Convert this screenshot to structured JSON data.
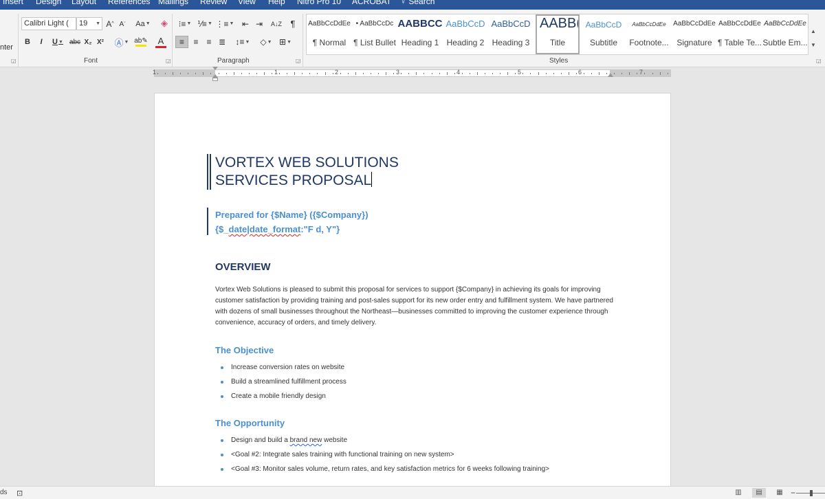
{
  "menu": {
    "tabs": [
      "Insert",
      "Design",
      "Layout",
      "References",
      "Mailings",
      "Review",
      "View",
      "Help",
      "Nitro Pro 10",
      "ACROBAT"
    ],
    "search_label": "Search"
  },
  "ribbon": {
    "clipboard_partial_label": "nter",
    "font": {
      "group_label": "Font",
      "font_name": "Calibri Light (",
      "font_size": "19",
      "bold": "B",
      "italic": "I",
      "underline": "U",
      "strikethrough": "abc",
      "subscript": "X₂",
      "superscript": "X²",
      "grow": "A",
      "shrink": "A",
      "change_case": "Aa",
      "font_color_letter": "A",
      "font_color": "#e02020",
      "highlight_color": "#f2e600"
    },
    "paragraph": {
      "group_label": "Paragraph",
      "pilcrow": "¶",
      "sort_label": "A↓Z"
    },
    "styles": {
      "group_label": "Styles",
      "items": [
        {
          "preview": "AaBbCcDdEe",
          "name": "¶ Normal"
        },
        {
          "preview": "• AaBbCcDc",
          "name": "¶ List Bullet"
        },
        {
          "preview": "AABBCC",
          "name": "Heading 1"
        },
        {
          "preview": "AaBbCcD",
          "name": "Heading 2"
        },
        {
          "preview": "AaBbCcD",
          "name": "Heading 3"
        },
        {
          "preview": "AABB(",
          "name": "Title"
        },
        {
          "preview": "AaBbCcD",
          "name": "Subtitle"
        },
        {
          "preview": "AaBbCcDdEe",
          "name": "Footnote..."
        },
        {
          "preview": "AaBbCcDdEe",
          "name": "Signature"
        },
        {
          "preview": "AaBbCcDdEe",
          "name": "¶ Table Te..."
        },
        {
          "preview": "AaBbCcDdEe",
          "name": "Subtle Em..."
        }
      ],
      "selected": "Title"
    }
  },
  "ruler": {
    "numbers": [
      "1",
      "1",
      "2",
      "3",
      "4",
      "5",
      "6",
      "7"
    ]
  },
  "document": {
    "title_line1": "VORTEX WEB SOLUTIONS",
    "title_line2": "SERVICES PROPOSAL",
    "subtitle_line1": "Prepared for {$Name} ({$Company})",
    "subtitle_line2_a": "{$_",
    "subtitle_line2_b": "date|date_format",
    "subtitle_line2_c": ":\"F d, Y\"}",
    "overview_heading": "OVERVIEW",
    "overview_paragraph": "Vortex Web Solutions is pleased to submit this proposal for services to support {$Company} in achieving its goals for improving customer satisfaction by providing training and post-sales support for its new order entry and fulfillment system. We have partnered with dozens of small businesses throughout the Northeast—businesses committed to improving the customer experience through convenience, accuracy of orders, and timely delivery.",
    "objective_heading": "The Objective",
    "objective_items": [
      "Increase conversion rates on website",
      "Build a streamlined fulfillment process",
      "Create a mobile friendly design"
    ],
    "opportunity_heading": "The Opportunity",
    "opportunity_item1_a": "Design and build a ",
    "opportunity_item1_b": "brand new",
    "opportunity_item1_c": " website",
    "opportunity_items": [
      "<Goal #2: Integrate sales training with functional training on new system>",
      "<Goal #3: Monitor sales volume, return rates, and key satisfaction metrics for 6 weeks following training>"
    ]
  },
  "status": {
    "left_text": "ds"
  },
  "colors": {
    "title_blue": "#1f3864",
    "accent_blue": "#4a90d0",
    "ribbon_blue": "#2b579a"
  }
}
